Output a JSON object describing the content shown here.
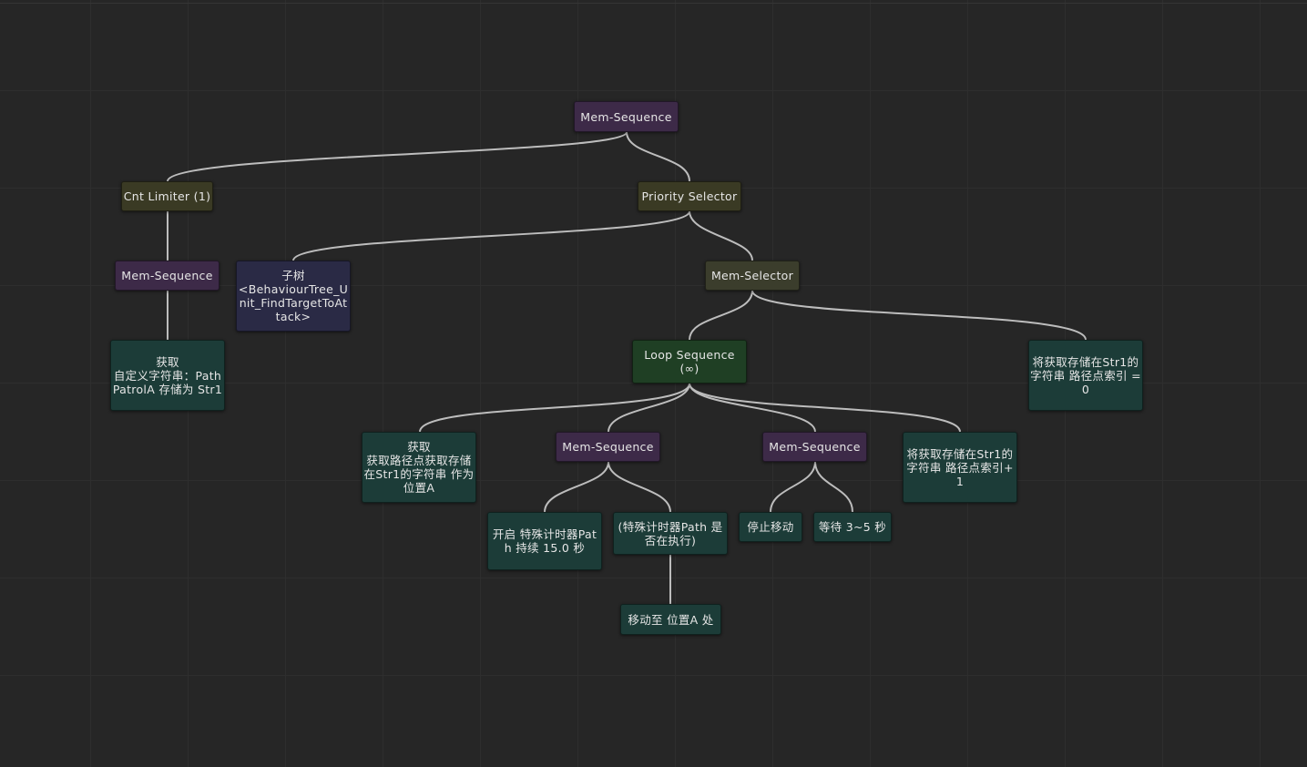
{
  "nodes": {
    "root": "Mem-Sequence",
    "cnt_limiter": "Cnt Limiter (1)",
    "priority_selector": "Priority Selector",
    "left_sequence": "Mem-Sequence",
    "subtree": "子树\n<BehaviourTree_Unit_FindTargetToAttack>",
    "mem_selector": "Mem-Selector",
    "get_custom_string": "获取\n自定义字符串：PathPatrolA 存储为 Str1",
    "loop_sequence": "Loop Sequence (∞)",
    "reset_index": "将获取存储在Str1的字符串 路径点索引 = 0",
    "get_waypoint": "获取\n获取路径点获取存储在Str1的字符串 作为 位置A",
    "timer_sequence": "Mem-Sequence",
    "stop_sequence": "Mem-Sequence",
    "increment_index": "将获取存储在Str1的字符串 路径点索引+1",
    "start_timer": "开启 特殊计时器Path 持续 15.0 秒",
    "timer_check": "(特殊计时器Path 是否在执行)",
    "stop_move": "停止移动",
    "wait": "等待 3~5 秒",
    "move_to": "移动至 位置A 处"
  }
}
